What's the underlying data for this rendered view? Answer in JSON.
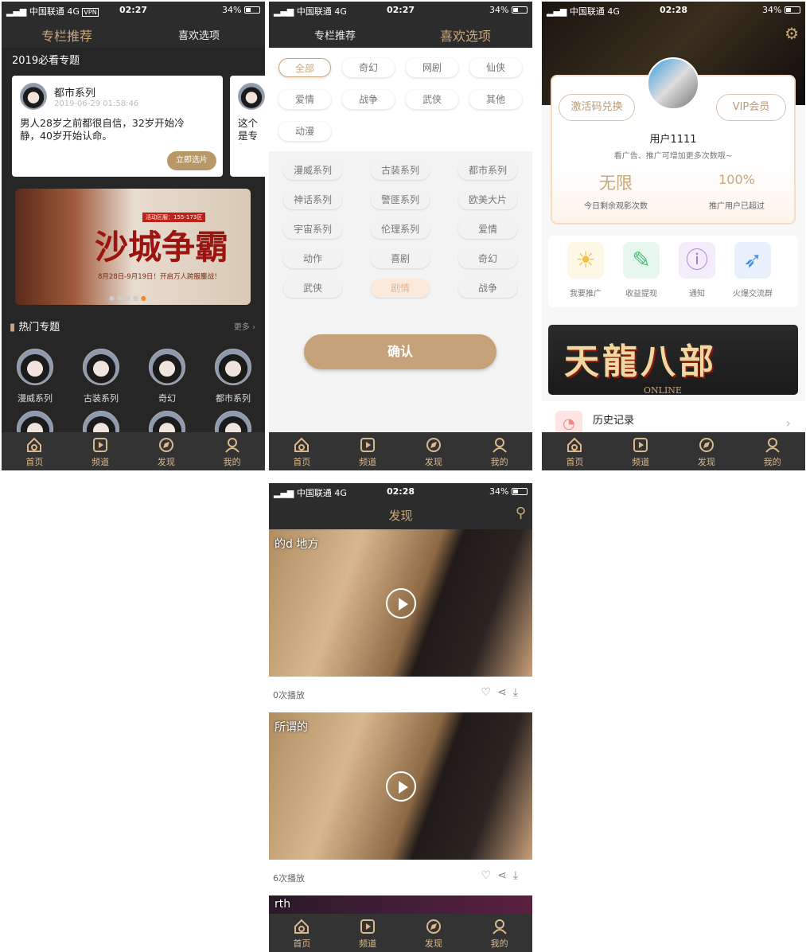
{
  "status": {
    "carrier": "中国联通",
    "network": "4G",
    "vpn": "VPN",
    "battery": "34%",
    "times": [
      "02:27",
      "02:27",
      "02:28",
      "02:28"
    ]
  },
  "tabbar": {
    "items": [
      "首页",
      "频道",
      "发现",
      "我的"
    ]
  },
  "colors": {
    "gold": "#c9a77c",
    "dark": "#262626",
    "tabbar": "#333333"
  },
  "screen1": {
    "tabs": [
      "专栏推荐",
      "喜欢选项"
    ],
    "section_title": "2019必看专题",
    "card": {
      "title": "都市系列",
      "date": "2019-06-29 01:58:46",
      "text": "男人28岁之前都很自信，32岁开始冷静，40岁开始认命。",
      "button": "立即选片"
    },
    "card2_text": "这个是专题。",
    "banner": {
      "logo_text": "沙城争霸",
      "badge": "活动区服：155-173区",
      "subtitle": "8月28日-9月19日！开启万人跨服鏖战！"
    },
    "hot": {
      "title": "热门专题",
      "more": "更多",
      "items": [
        "漫威系列",
        "古装系列",
        "奇幻",
        "都市系列"
      ]
    }
  },
  "screen2": {
    "tabs": [
      "专栏推荐",
      "喜欢选项"
    ],
    "top_chips": [
      "全部",
      "奇幻",
      "网剧",
      "仙侠",
      "爱情",
      "战争",
      "武侠",
      "其他",
      "动漫"
    ],
    "selected_top": "全部",
    "chips": [
      "漫威系列",
      "古装系列",
      "都市系列",
      "神话系列",
      "警匪系列",
      "欧美大片",
      "宇宙系列",
      "伦理系列",
      "爱情",
      "动作",
      "喜剧",
      "奇幻",
      "武侠",
      "剧情",
      "战争"
    ],
    "selected_chip": "剧情",
    "confirm": "确认"
  },
  "screen3": {
    "redeem": "激活码兑换",
    "vip": "VIP会员",
    "username": "用户1111",
    "hint": "看广告、推广可增加更多次数哦~",
    "stats": [
      {
        "value": "无限",
        "label": "今日剩余观影次数"
      },
      {
        "value": "100%",
        "label": "推广用户已超过"
      }
    ],
    "actions": [
      {
        "label": "我要推广",
        "icon": "sun-icon",
        "color": "#f0c040"
      },
      {
        "label": "收益提现",
        "icon": "withdraw-icon",
        "color": "#4cc07a"
      },
      {
        "label": "通知",
        "icon": "info-icon",
        "color": "#a47be0"
      },
      {
        "label": "火爆交流群",
        "icon": "rocket-icon",
        "color": "#4a90e2"
      }
    ],
    "banner": {
      "logo_text": "天龍八部",
      "sub": "ONLINE"
    },
    "history": {
      "title": "历史记录"
    }
  },
  "screen4": {
    "title": "发现",
    "videos": [
      {
        "title": "的d 地方",
        "plays": "0次播放"
      },
      {
        "title": "所谓的",
        "plays": "6次播放"
      },
      {
        "title": "rth"
      }
    ]
  }
}
